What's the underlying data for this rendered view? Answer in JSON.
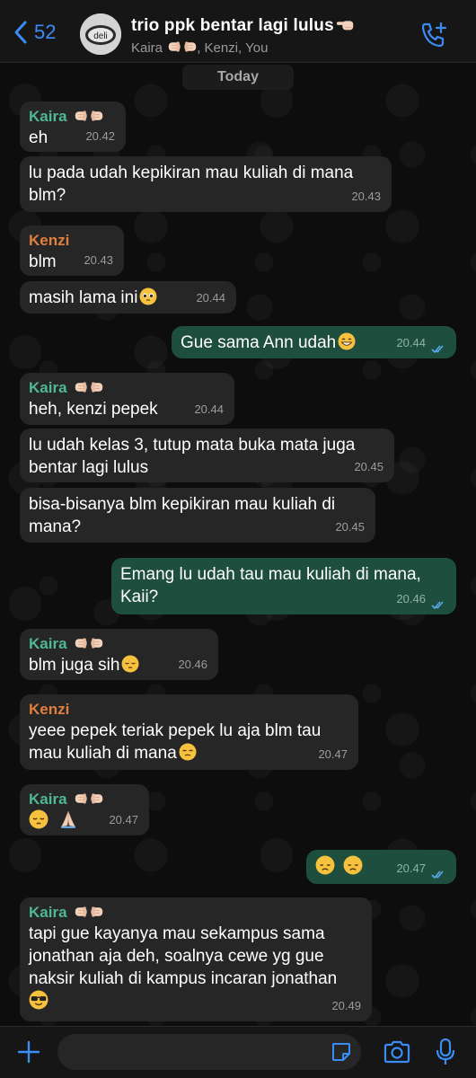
{
  "header": {
    "back_count": "52",
    "title": "trio ppk bentar lagi lulus",
    "subtitle_part1": "Kaira ",
    "subtitle_part2": ", Kenzi, You",
    "avatar_text": "deli"
  },
  "chat": {
    "date_label": "Today",
    "messages": [
      {
        "sender": "Kaira",
        "text": "eh",
        "time": "20.42"
      },
      {
        "text": "lu pada udah kepikiran mau kuliah di mana blm?",
        "time": "20.43"
      },
      {
        "sender": "Kenzi",
        "text": "blm",
        "time": "20.43"
      },
      {
        "text": "masih lama ini",
        "time": "20.44"
      },
      {
        "text": "Gue sama Ann udah",
        "time": "20.44",
        "outgoing": true
      },
      {
        "sender": "Kaira",
        "text": "heh, kenzi pepek",
        "time": "20.44"
      },
      {
        "text": "lu udah kelas 3, tutup mata buka mata juga bentar lagi lulus",
        "time": "20.45"
      },
      {
        "text": "bisa-bisanya blm kepikiran mau kuliah di mana?",
        "time": "20.45"
      },
      {
        "text": "Emang lu udah tau mau kuliah di mana, Kaii?",
        "time": "20.46",
        "outgoing": true
      },
      {
        "sender": "Kaira",
        "text": "blm juga sih",
        "time": "20.46"
      },
      {
        "sender": "Kenzi",
        "text": "yeee pepek teriak pepek lu aja blm tau mau kuliah di mana",
        "time": "20.47"
      },
      {
        "sender": "Kaira",
        "text": "",
        "time": "20.47"
      },
      {
        "text": "",
        "time": "20.47",
        "outgoing": true
      },
      {
        "sender": "Kaira",
        "text": "tapi gue kayanya mau sekampus sama jonathan aja deh, soalnya cewe yg gue naksir kuliah di kampus incaran jonathan",
        "time": "20.49"
      }
    ]
  },
  "colors": {
    "accent": "#3b8df6",
    "outgoing_bubble": "#1e4e3d",
    "incoming_bubble": "#262626",
    "kaira_name": "#4fb894",
    "kenzi_name": "#e07f3e"
  },
  "icons": [
    "chevron-left-icon",
    "add-call-icon",
    "plus-icon",
    "sticker-icon",
    "camera-icon",
    "microphone-icon"
  ]
}
